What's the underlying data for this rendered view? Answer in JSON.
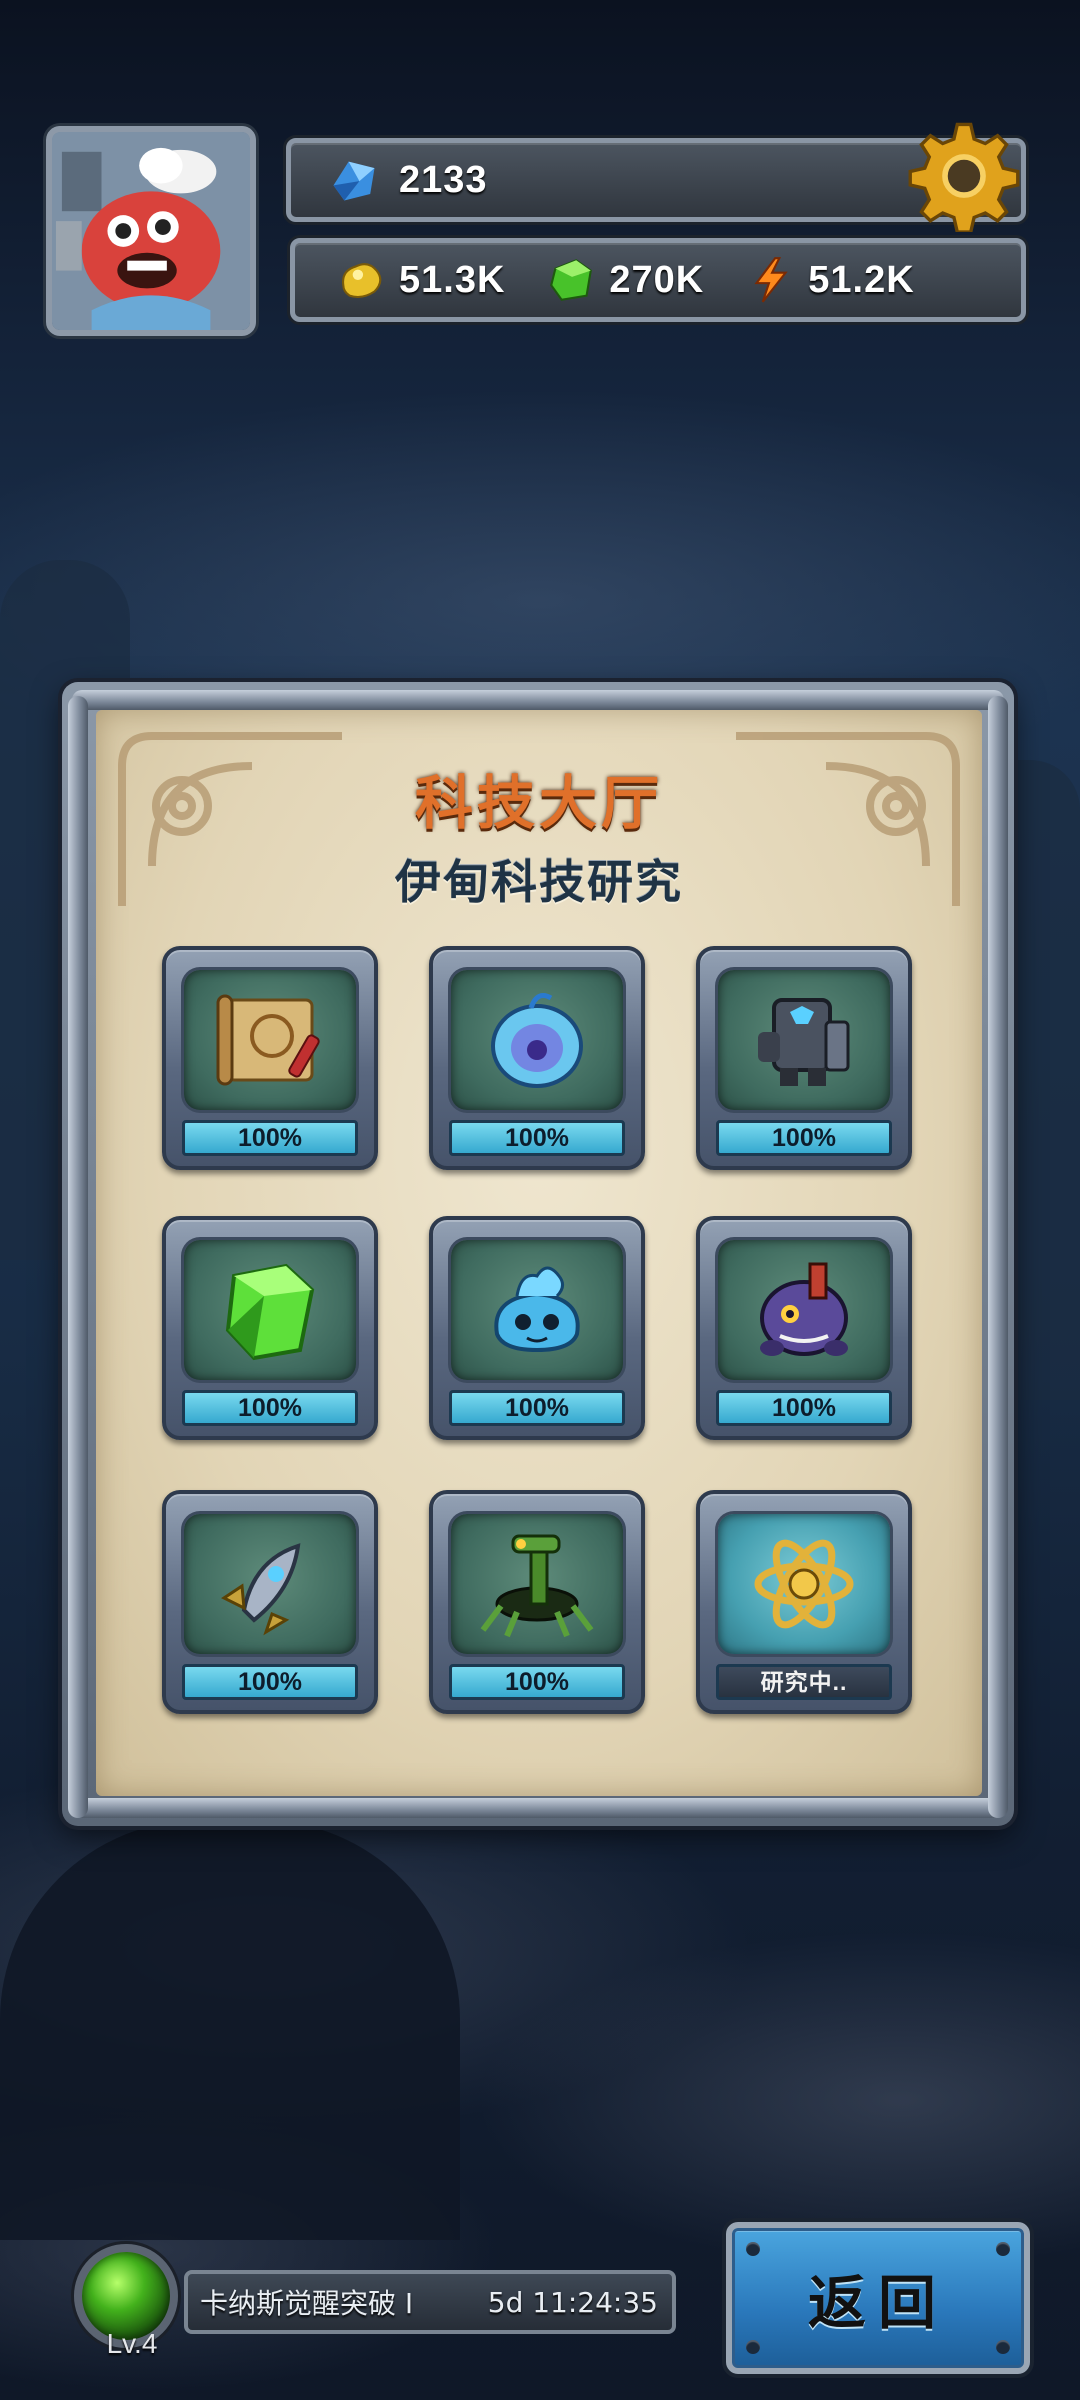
{
  "header": {
    "gems": "2133",
    "resources": [
      {
        "icon": "gold-ore-icon",
        "value": "51.3K"
      },
      {
        "icon": "green-crystal-icon",
        "value": "270K"
      },
      {
        "icon": "lightning-icon",
        "value": "51.2K"
      }
    ]
  },
  "panel": {
    "title": "科技大厅",
    "subtitle": "伊甸科技研究",
    "slots": [
      {
        "icon": "treasure-map-icon",
        "status": "100%"
      },
      {
        "icon": "blue-orb-creature-icon",
        "status": "100%"
      },
      {
        "icon": "robot-armor-icon",
        "status": "100%"
      },
      {
        "icon": "green-crystal-icon",
        "status": "100%"
      },
      {
        "icon": "blue-slime-creature-icon",
        "status": "100%"
      },
      {
        "icon": "purple-tank-creature-icon",
        "status": "100%"
      },
      {
        "icon": "spaceship-icon",
        "status": "100%"
      },
      {
        "icon": "mech-spider-icon",
        "status": "100%"
      },
      {
        "icon": "golden-atom-icon",
        "status": "研究中.."
      }
    ]
  },
  "quest": {
    "level": "Lv.4",
    "name": "卡纳斯觉醒突破 Ⅰ",
    "timer": "5d 11:24:35"
  },
  "back_button": "返回",
  "colors": {
    "title": "#e0702a",
    "progress_bar": "#4fc0e0",
    "back_button": "#2a78bb"
  }
}
